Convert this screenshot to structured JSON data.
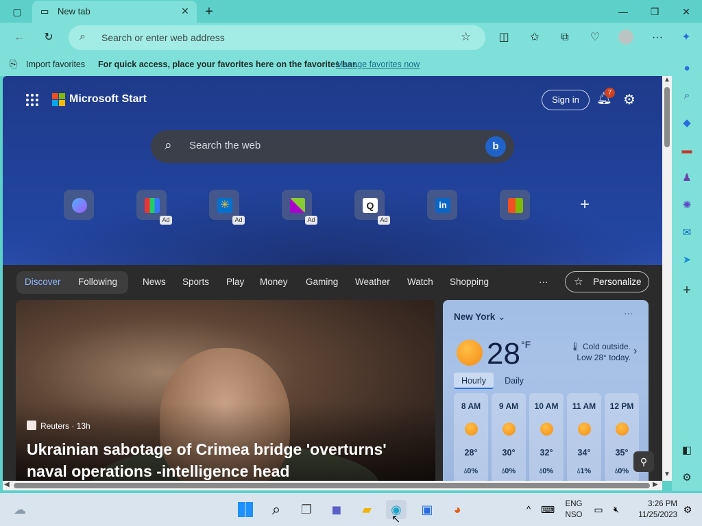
{
  "browser": {
    "tab_title": "New tab",
    "address_placeholder": "Search or enter web address",
    "favorites": {
      "import_label": "Import favorites",
      "hint": "For quick access, place your favorites here on the favorites bar.",
      "manage_link": "Manage favorites now"
    }
  },
  "page": {
    "brand": "Microsoft Start",
    "signin_label": "Sign in",
    "notification_count": "7",
    "search_placeholder": "Search the web",
    "quick_links": [
      {
        "name": "copilot",
        "ad": ""
      },
      {
        "name": "shopping",
        "ad": "Ad"
      },
      {
        "name": "walmart",
        "ad": "Ad"
      },
      {
        "name": "game",
        "ad": "Ad"
      },
      {
        "name": "search-app",
        "ad": "Ad"
      },
      {
        "name": "linkedin",
        "ad": ""
      },
      {
        "name": "microsoft-store",
        "ad": ""
      }
    ],
    "nav": {
      "discover": "Discover",
      "following": "Following",
      "items": [
        "News",
        "Sports",
        "Play",
        "Money",
        "Gaming",
        "Weather",
        "Watch",
        "Shopping"
      ],
      "more": "···",
      "personalize": "Personalize"
    },
    "hero": {
      "source": "Reuters · 13h",
      "headline": "Ukrainian sabotage of Crimea bridge 'overturns' naval operations -intelligence head"
    },
    "weather": {
      "city": "New York",
      "temp": "28",
      "unit": "°F",
      "description": "Cold outside. Low 28° today.",
      "tabs": [
        "Hourly",
        "Daily"
      ],
      "hourly": [
        {
          "time": "8 AM",
          "temp": "28°",
          "precip": "0%"
        },
        {
          "time": "9 AM",
          "temp": "30°",
          "precip": "0%"
        },
        {
          "time": "10 AM",
          "temp": "32°",
          "precip": "0%"
        },
        {
          "time": "11 AM",
          "temp": "34°",
          "precip": "1%"
        },
        {
          "time": "12 PM",
          "temp": "35°",
          "precip": "0%"
        }
      ]
    }
  },
  "taskbar": {
    "lang_top": "ENG",
    "lang_bottom": "NSO",
    "time": "3:26 PM",
    "date": "11/25/2023"
  },
  "colors": {
    "chrome": "#5dd0ca",
    "toolbar": "#7fe0d9",
    "nav_bg": "#2b2b2b",
    "accent": "#6ea8ff"
  }
}
